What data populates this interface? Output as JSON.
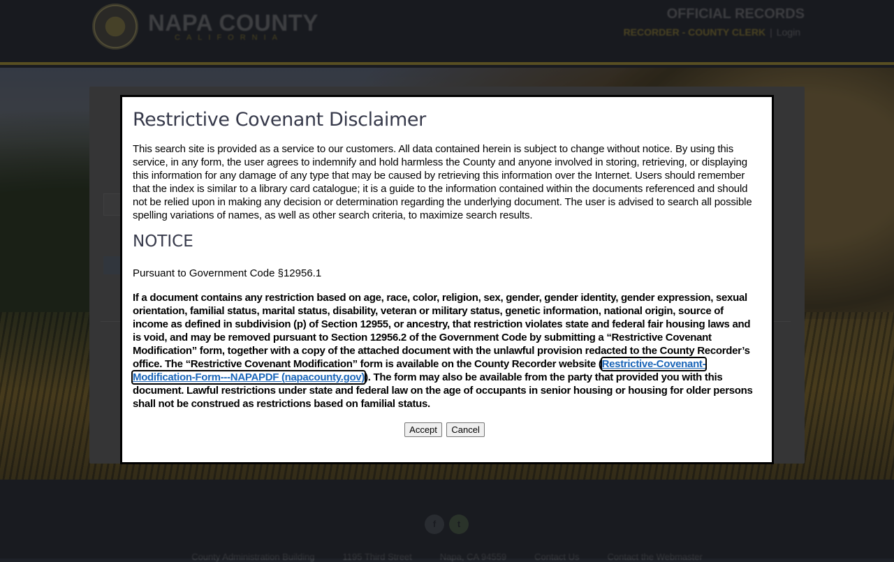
{
  "header": {
    "brand_name": "NAPA COUNTY",
    "brand_sub": "CALIFORNIA",
    "section_title": "OFFICIAL RECORDS",
    "recorder_link": "RECORDER - COUNTY CLERK",
    "separator": "|",
    "login_link": "Login"
  },
  "footer": {
    "links": [
      "County Administration Building",
      "1195 Third Street",
      "Napa, CA 94559",
      "Contact Us",
      "Contact the Webmaster"
    ],
    "social": [
      "facebook-icon",
      "twitter-icon"
    ]
  },
  "modal": {
    "title": "Restrictive Covenant Disclaimer",
    "disclaimer": "This search site is provided as a service to our customers. All data contained herein is subject to change without notice. By using this service, in any form, the user agrees to indemnify and hold harmless the County and anyone involved in storing, retrieving, or displaying this information for any damage of any type that may be caused by retrieving this information over the Internet. Users should remember that the index is similar to a library card catalogue; it is a guide to the information contained within the documents referenced and should not be relied upon in making any decision or determination regarding the underlying document. The user is advised to search all possible spelling variations of names, as well as other search criteria, to maximize search results.",
    "notice_heading": "NOTICE",
    "pursuant": "Pursuant to Government Code §12956.1",
    "notice_before_link": "If a document contains any restriction based on age, race, color, religion, sex, gender, gender identity, gender expression, sexual orientation, familial status, marital status, disability, veteran or military status, genetic information, national origin, source of income as defined in subdivision (p) of Section 12955, or ancestry, that restriction violates state and federal fair housing laws and is void, and may be removed pursuant to Section 12956.2 of the Government Code by submitting a “Restrictive Covenant Modification” form, together with a copy of the attached document with the unlawful provision redacted to the County Recorder’s office. The “Restrictive Covenant Modification” form is available on the County Recorder website (",
    "link_text": "Restrictive-Covenant-Modification-Form---NAPAPDF (napacounty.gov)",
    "notice_after_link": "). The form may also be available from the party that provided you with this document. Lawful restrictions under state and federal law on the age of occupants in senior housing or housing for older persons shall not be construed as restrictions based on familial status.",
    "accept_label": "Accept",
    "cancel_label": "Cancel"
  }
}
